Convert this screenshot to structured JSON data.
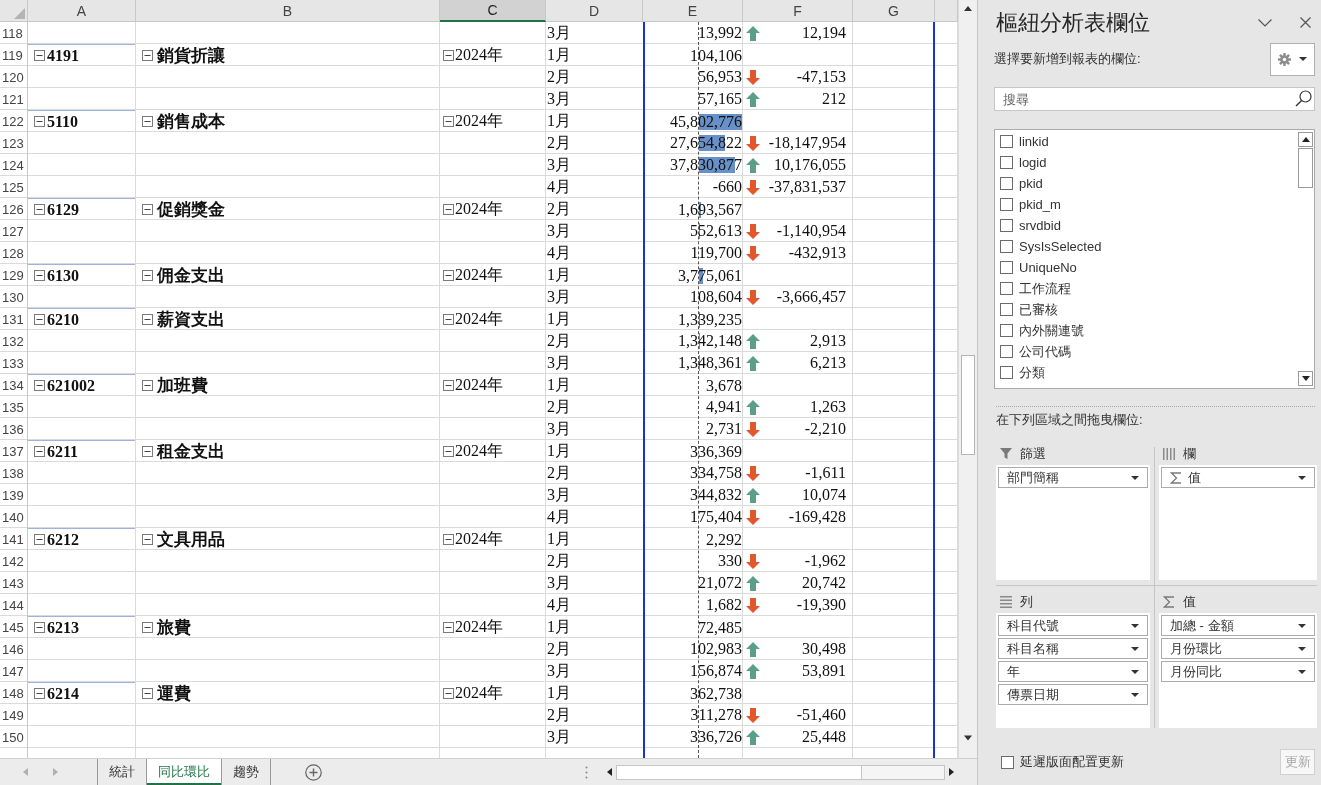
{
  "sheet": {
    "columns": [
      {
        "label": "A",
        "selected": false
      },
      {
        "label": "B",
        "selected": false
      },
      {
        "label": "C",
        "selected": true
      },
      {
        "label": "D",
        "selected": false
      },
      {
        "label": "E",
        "selected": false
      },
      {
        "label": "F",
        "selected": false
      },
      {
        "label": "G",
        "selected": false
      }
    ],
    "rows": [
      {
        "number": "118",
        "month": "3月",
        "amount": "13,992",
        "up": true,
        "change": "12,194"
      },
      {
        "number": "119",
        "code": {
          "text": "4191",
          "expanded": true
        },
        "name": {
          "text": "銷貨折讓",
          "expanded": true
        },
        "year": {
          "text": "2024年",
          "expanded": true
        },
        "month": "1月",
        "amount": "104,106"
      },
      {
        "number": "120",
        "month": "2月",
        "amount": "56,953",
        "up": false,
        "change": "-47,153"
      },
      {
        "number": "121",
        "month": "3月",
        "amount": "57,165",
        "up": true,
        "change": "212"
      },
      {
        "number": "122",
        "code": {
          "text": "5110",
          "expanded": true
        },
        "name": {
          "text": "銷售成本",
          "expanded": true
        },
        "year": {
          "text": "2024年",
          "expanded": true
        },
        "month": "1月",
        "amount": "45,802,776"
      },
      {
        "number": "123",
        "month": "2月",
        "amount": "27,654,822",
        "up": false,
        "change": "-18,147,954"
      },
      {
        "number": "124",
        "month": "3月",
        "amount": "37,830,877",
        "up": true,
        "change": "10,176,055"
      },
      {
        "number": "125",
        "month": "4月",
        "amount": "-660",
        "up": false,
        "change": "-37,831,537"
      },
      {
        "number": "126",
        "code": {
          "text": "6129",
          "expanded": true
        },
        "name": {
          "text": "促銷獎金",
          "expanded": true
        },
        "year": {
          "text": "2024年",
          "expanded": true
        },
        "month": "2月",
        "amount": "1,693,567"
      },
      {
        "number": "127",
        "month": "3月",
        "amount": "552,613",
        "up": false,
        "change": "-1,140,954"
      },
      {
        "number": "128",
        "month": "4月",
        "amount": "119,700",
        "up": false,
        "change": "-432,913"
      },
      {
        "number": "129",
        "code": {
          "text": "6130",
          "expanded": true
        },
        "name": {
          "text": "佣金支出",
          "expanded": true
        },
        "year": {
          "text": "2024年",
          "expanded": true
        },
        "month": "1月",
        "amount": "3,775,061"
      },
      {
        "number": "130",
        "month": "3月",
        "amount": "108,604",
        "up": false,
        "change": "-3,666,457"
      },
      {
        "number": "131",
        "code": {
          "text": "6210",
          "expanded": true
        },
        "name": {
          "text": "薪資支出",
          "expanded": true
        },
        "year": {
          "text": "2024年",
          "expanded": true
        },
        "month": "1月",
        "amount": "1,339,235"
      },
      {
        "number": "132",
        "month": "2月",
        "amount": "1,342,148",
        "up": true,
        "change": "2,913"
      },
      {
        "number": "133",
        "month": "3月",
        "amount": "1,348,361",
        "up": true,
        "change": "6,213"
      },
      {
        "number": "134",
        "code": {
          "text": "621002",
          "expanded": true
        },
        "name": {
          "text": "加班費",
          "expanded": true
        },
        "year": {
          "text": "2024年",
          "expanded": true
        },
        "month": "1月",
        "amount": "3,678"
      },
      {
        "number": "135",
        "month": "2月",
        "amount": "4,941",
        "up": true,
        "change": "1,263"
      },
      {
        "number": "136",
        "month": "3月",
        "amount": "2,731",
        "up": false,
        "change": "-2,210"
      },
      {
        "number": "137",
        "code": {
          "text": "6211",
          "expanded": true
        },
        "name": {
          "text": "租金支出",
          "expanded": true
        },
        "year": {
          "text": "2024年",
          "expanded": true
        },
        "month": "1月",
        "amount": "336,369"
      },
      {
        "number": "138",
        "month": "2月",
        "amount": "334,758",
        "up": false,
        "change": "-1,611"
      },
      {
        "number": "139",
        "month": "3月",
        "amount": "344,832",
        "up": true,
        "change": "10,074"
      },
      {
        "number": "140",
        "month": "4月",
        "amount": "175,404",
        "up": false,
        "change": "-169,428"
      },
      {
        "number": "141",
        "code": {
          "text": "6212",
          "expanded": true
        },
        "name": {
          "text": "文具用品",
          "expanded": true
        },
        "year": {
          "text": "2024年",
          "expanded": true
        },
        "month": "1月",
        "amount": "2,292"
      },
      {
        "number": "142",
        "month": "2月",
        "amount": "330",
        "up": false,
        "change": "-1,962"
      },
      {
        "number": "143",
        "month": "3月",
        "amount": "21,072",
        "up": true,
        "change": "20,742"
      },
      {
        "number": "144",
        "month": "4月",
        "amount": "1,682",
        "up": false,
        "change": "-19,390"
      },
      {
        "number": "145",
        "code": {
          "text": "6213",
          "expanded": true
        },
        "name": {
          "text": "旅費",
          "expanded": true
        },
        "year": {
          "text": "2024年",
          "expanded": true
        },
        "month": "1月",
        "amount": "72,485"
      },
      {
        "number": "146",
        "month": "2月",
        "amount": "102,983",
        "up": true,
        "change": "30,498"
      },
      {
        "number": "147",
        "month": "3月",
        "amount": "156,874",
        "up": true,
        "change": "53,891"
      },
      {
        "number": "148",
        "code": {
          "text": "6214",
          "expanded": true
        },
        "name": {
          "text": "運費",
          "expanded": true
        },
        "year": {
          "text": "2024年",
          "expanded": true
        },
        "month": "1月",
        "amount": "362,738"
      },
      {
        "number": "149",
        "month": "2月",
        "amount": "311,278",
        "up": false,
        "change": "-51,460"
      },
      {
        "number": "150",
        "month": "3月",
        "amount": "336,726",
        "up": true,
        "change": "25,448"
      }
    ]
  },
  "sheet_tabs": [
    {
      "label": "統計",
      "selected": false
    },
    {
      "label": "同比環比",
      "selected": true
    },
    {
      "label": "趨勢",
      "selected": false
    }
  ],
  "pivot_pane": {
    "title": "樞紐分析表欄位",
    "instruction": "選擇要新增到報表的欄位:",
    "search": {
      "placeholder": "搜尋"
    },
    "fields": [
      {
        "label": "linkid",
        "checked": false
      },
      {
        "label": "logid",
        "checked": false
      },
      {
        "label": "pkid",
        "checked": false
      },
      {
        "label": "pkid_m",
        "checked": false
      },
      {
        "label": "srvdbid",
        "checked": false
      },
      {
        "label": "SysIsSelected",
        "checked": false
      },
      {
        "label": "UniqueNo",
        "checked": false
      },
      {
        "label": "工作流程",
        "checked": false
      },
      {
        "label": "已審核",
        "checked": false
      },
      {
        "label": "內外關連號",
        "checked": false
      },
      {
        "label": "公司代碼",
        "checked": false
      },
      {
        "label": "分類",
        "checked": false
      }
    ],
    "areas_instruction": "在下列區域之間拖曳欄位:",
    "areas": [
      {
        "kind": "filters",
        "title": "篩選",
        "items": [
          {
            "label": "部門簡稱",
            "kind": "field"
          }
        ]
      },
      {
        "kind": "columns",
        "title": "欄",
        "items": [
          {
            "label": "值",
            "kind": "values"
          }
        ]
      },
      {
        "kind": "rows",
        "title": "列",
        "items": [
          {
            "label": "科目代號",
            "kind": "field"
          },
          {
            "label": "科目名稱",
            "kind": "field"
          },
          {
            "label": "年",
            "kind": "field"
          },
          {
            "label": "傳票日期",
            "kind": "field"
          }
        ]
      },
      {
        "kind": "values",
        "title": "值",
        "items": [
          {
            "label": "加總 - 金額",
            "kind": "field"
          },
          {
            "label": "月份環比",
            "kind": "field"
          },
          {
            "label": "月份同比",
            "kind": "field"
          }
        ]
      }
    ],
    "defer_update": {
      "label": "延遲版面配置更新",
      "checked": false
    },
    "update_button": {
      "label": "更新",
      "disabled": true
    }
  }
}
